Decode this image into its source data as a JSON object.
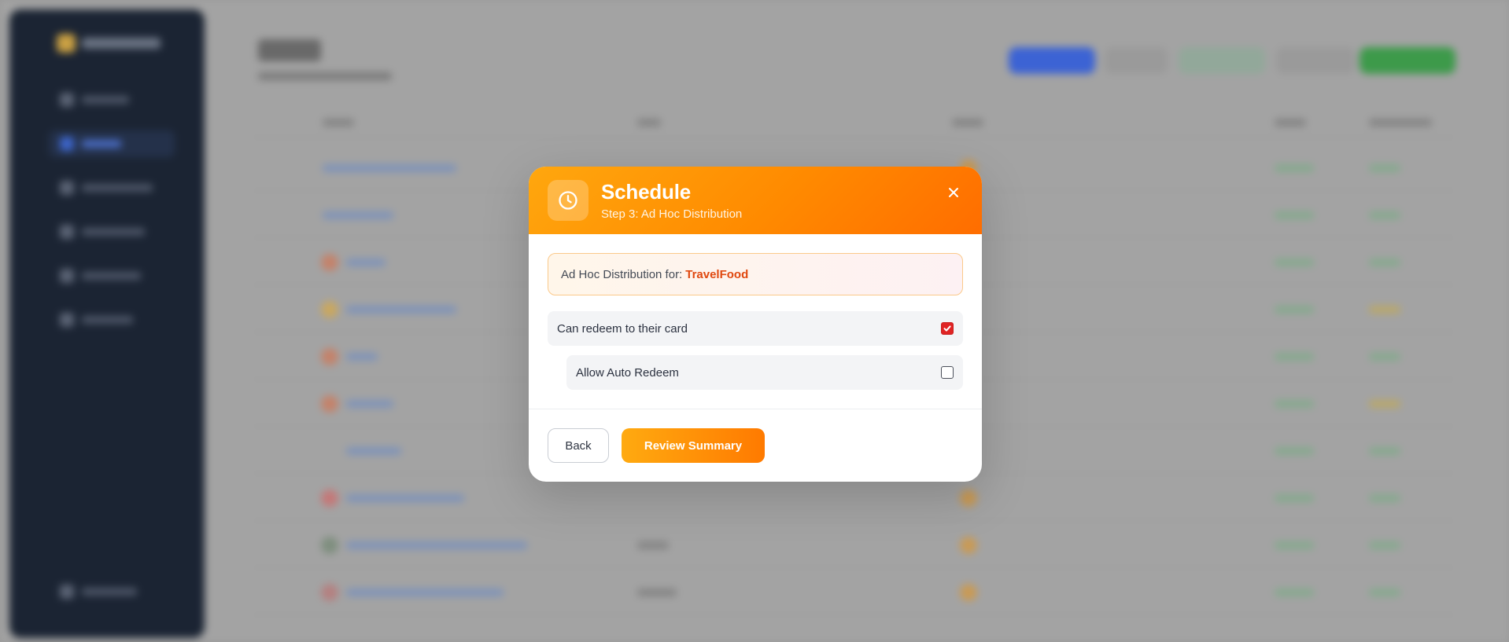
{
  "modal": {
    "title": "Schedule",
    "subtitle": "Step 3: Ad Hoc Distribution",
    "header_icon": "clock-icon",
    "close_icon": "close-icon",
    "banner": {
      "label": "Ad Hoc Distribution for:",
      "company": "TravelFood"
    },
    "options": [
      {
        "label": "Can redeem to their card",
        "checked": true
      },
      {
        "label": "Allow Auto Redeem",
        "checked": false
      }
    ],
    "buttons": {
      "back_label": "Back",
      "review_label": "Review Summary"
    }
  },
  "colors": {
    "accent_start": "#ffa70e",
    "accent_end": "#ff6d00",
    "company_text": "#e0480f",
    "checkbox_checked": "#e02424",
    "sidebar_bg": "#1b2433"
  }
}
